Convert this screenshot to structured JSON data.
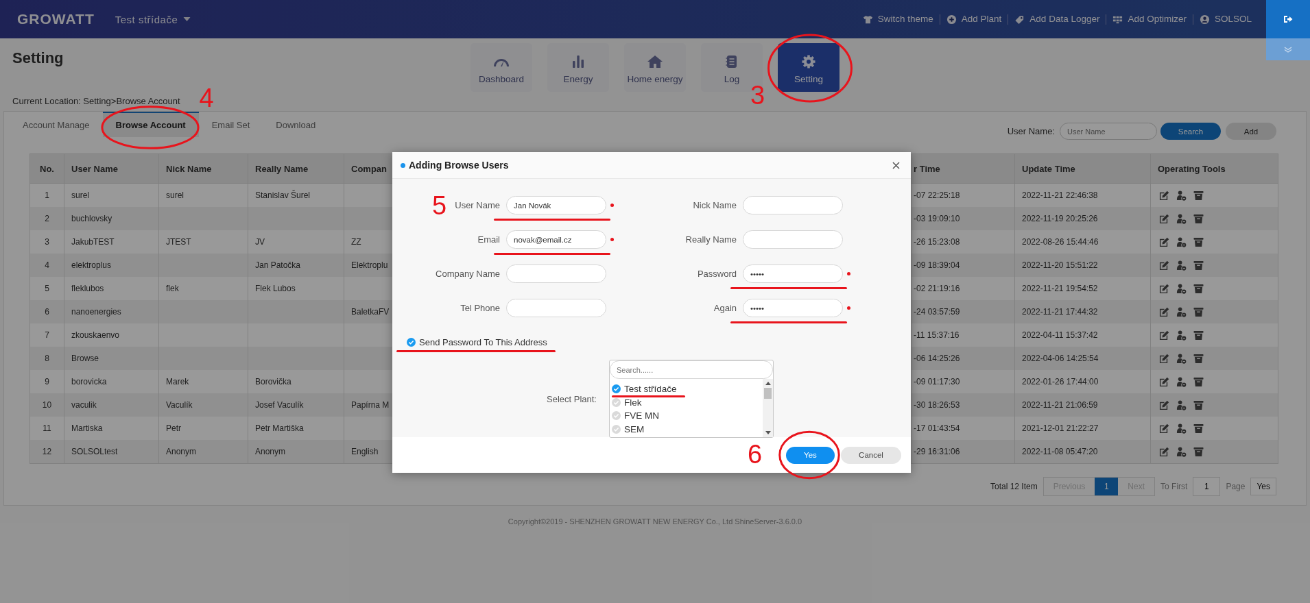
{
  "header": {
    "logo": "GROWATT",
    "plant_selector": "Test střídače",
    "actions": [
      "Switch theme",
      "Add Plant",
      "Add Data Logger",
      "Add Optimizer",
      "SOLSOL"
    ]
  },
  "page_title": "Setting",
  "nav": [
    {
      "label": "Dashboard",
      "selected": false
    },
    {
      "label": "Energy",
      "selected": false
    },
    {
      "label": "Home energy",
      "selected": false
    },
    {
      "label": "Log",
      "selected": false
    },
    {
      "label": "Setting",
      "selected": true,
      "annotation": "3",
      "circled": true
    }
  ],
  "breadcrumb": "Current Location: Setting>Browse Account",
  "tabs": [
    {
      "label": "Account Manage",
      "selected": false
    },
    {
      "label": "Browse Account",
      "selected": true,
      "annotation": "4",
      "circled": true
    },
    {
      "label": "Email Set",
      "selected": false
    },
    {
      "label": "Download",
      "selected": false
    }
  ],
  "search": {
    "label": "User Name:",
    "placeholder": "User Name",
    "buttons": [
      "Search",
      "Add"
    ]
  },
  "table": {
    "columns": [
      "No.",
      "User Name",
      "Nick Name",
      "Really Name",
      "Compan",
      "r Time",
      "Update Time",
      "Operating Tools"
    ],
    "rows": [
      {
        "no": "1",
        "user_name": "surel",
        "nick_name": "surel",
        "really_name": "Stanislav Šurel",
        "column_6": "-07 22:25:18",
        "update_time": "2022-11-21 22:46:38"
      },
      {
        "no": "2",
        "user_name": "buchlovsky",
        "column_6": "-03 19:09:10",
        "update_time": "2022-11-19 20:25:26"
      },
      {
        "no": "3",
        "user_name": "JakubTEST",
        "nick_name": "JTEST",
        "really_name": "JV",
        "column_5": "ZZ",
        "column_6": "-26 15:23:08",
        "update_time": "2022-08-26 15:44:46"
      },
      {
        "no": "4",
        "user_name": "elektroplus",
        "really_name": "Jan Patočka",
        "column_5": "Elektroplu",
        "column_6": "-09 18:39:04",
        "update_time": "2022-11-20 15:51:22"
      },
      {
        "no": "5",
        "user_name": "fleklubos",
        "nick_name": "flek",
        "really_name": "Flek Lubos",
        "column_6": "-02 21:19:16",
        "update_time": "2022-11-21 19:54:52"
      },
      {
        "no": "6",
        "user_name": "nanoenergies",
        "column_5": "BaletkaFV",
        "column_6": "-24 03:57:59",
        "update_time": "2022-11-21 17:44:32"
      },
      {
        "no": "7",
        "user_name": "zkouskaenvo",
        "column_6": "-11 15:37:16",
        "update_time": "2022-04-11 15:37:42"
      },
      {
        "no": "8",
        "user_name": "Browse",
        "column_6": "-06 14:25:26",
        "update_time": "2022-04-06 14:25:54"
      },
      {
        "no": "9",
        "user_name": "borovicka",
        "nick_name": "Marek",
        "really_name": "Borovička",
        "column_6": "-09 01:17:30",
        "update_time": "2022-01-26 17:44:00"
      },
      {
        "no": "10",
        "user_name": "vaculik",
        "nick_name": "Vaculík",
        "really_name": "Josef Vaculík",
        "column_5": "Papírna M",
        "column_6": "-30 18:26:53",
        "update_time": "2022-11-21 21:06:59"
      },
      {
        "no": "11",
        "user_name": "Martiska",
        "nick_name": "Petr",
        "really_name": "Petr Martiška",
        "column_6": "-17 01:43:54",
        "update_time": "2021-12-01 21:22:27"
      },
      {
        "no": "12",
        "user_name": "SOLSOLtest",
        "nick_name": "Anonym",
        "really_name": "Anonym",
        "column_5": "English",
        "column_6": "-29 16:31:06",
        "update_time": "2022-11-08 05:47:20"
      }
    ]
  },
  "pagination": {
    "total": "Total 12 Item",
    "previous": {
      "label": "Previous",
      "disabled": true
    },
    "pages": [
      {
        "label": "1",
        "selected": true
      }
    ],
    "next": {
      "label": "Next",
      "disabled": true
    },
    "to_first": "To First",
    "page_input": "1",
    "page_label": "Page",
    "go": "Yes"
  },
  "copyright": "Copyright©2019 - SHENZHEN GROWATT NEW ENERGY Co., Ltd ShineServer-3.6.0.0",
  "modal": {
    "title": "Adding Browse Users",
    "fields": [
      {
        "label": "User Name",
        "value": "Jan Novák",
        "required": true,
        "underlined": true,
        "annotation": "5"
      },
      {
        "label": "Nick Name",
        "required": false,
        "underlined": false
      },
      {
        "label": "Email",
        "value": "novak@email.cz",
        "required": true,
        "underlined": true
      },
      {
        "label": "Really Name",
        "required": false,
        "underlined": false
      },
      {
        "label": "Company Name",
        "required": false,
        "underlined": false
      },
      {
        "label": "Password",
        "value": "•••••",
        "required": true,
        "underlined": true
      },
      {
        "label": "Tel Phone",
        "required": false,
        "underlined": false
      },
      {
        "label": "Again",
        "value": "•••••",
        "required": true,
        "underlined": true
      }
    ],
    "send_password": {
      "label": "Send Password To This Address",
      "checked": true,
      "underlined": true
    },
    "plant_select": {
      "label": "Select Plant:",
      "search_placeholder": "Search......",
      "items": [
        {
          "label": "Test střídače",
          "checked": true,
          "underlined": true
        },
        {
          "label": "Flek",
          "checked": false,
          "underlined": false
        },
        {
          "label": "FVE MN",
          "checked": false,
          "underlined": false
        },
        {
          "label": "SEM",
          "checked": false,
          "underlined": false
        }
      ]
    },
    "buttons": [
      {
        "label": "Yes",
        "annotation": "6",
        "circled": true
      },
      {
        "label": "Cancel",
        "circled": false
      }
    ]
  }
}
